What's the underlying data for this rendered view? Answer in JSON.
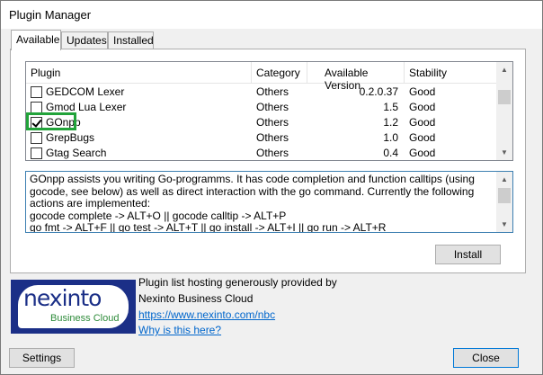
{
  "window": {
    "title": "Plugin Manager"
  },
  "tabs": [
    {
      "label": "Available",
      "active": true
    },
    {
      "label": "Updates",
      "active": false
    },
    {
      "label": "Installed",
      "active": false
    }
  ],
  "plugin_list": {
    "columns": [
      "Plugin",
      "Category",
      "Available Version",
      "Stability"
    ],
    "rows": [
      {
        "name": "GEDCOM Lexer",
        "category": "Others",
        "version": "0.2.0.37",
        "stability": "Good",
        "checked": false
      },
      {
        "name": "Gmod Lua Lexer",
        "category": "Others",
        "version": "1.5",
        "stability": "Good",
        "checked": false
      },
      {
        "name": "GOnpp",
        "category": "Others",
        "version": "1.2",
        "stability": "Good",
        "checked": true
      },
      {
        "name": "GrepBugs",
        "category": "Others",
        "version": "1.0",
        "stability": "Good",
        "checked": false
      },
      {
        "name": "Gtag Search",
        "category": "Others",
        "version": "0.4",
        "stability": "Good",
        "checked": false
      }
    ]
  },
  "description": "GOnpp assists you writing Go-programms. It has code completion and function calltips (using gocode, see below) as well as direct interaction with the go command. Currently the following actions are implemented:\ngocode complete -> ALT+O || gocode calltip -> ALT+P\ngo fmt -> ALT+F || go test -> ALT+T || go install -> ALT+I || go run -> ALT+R",
  "buttons": {
    "install": "Install",
    "settings": "Settings",
    "close": "Close"
  },
  "hosting": {
    "line1": "Plugin list hosting generously provided by",
    "line2": "Nexinto Business Cloud",
    "link1": "https://www.nexinto.com/nbc",
    "link2": "Why is this here?"
  },
  "logo": {
    "word": "nexinto",
    "tagline": "Business Cloud"
  },
  "colors": {
    "highlight": "#22a33a",
    "link": "#0066cc",
    "logo_bg": "#1b2f87"
  }
}
